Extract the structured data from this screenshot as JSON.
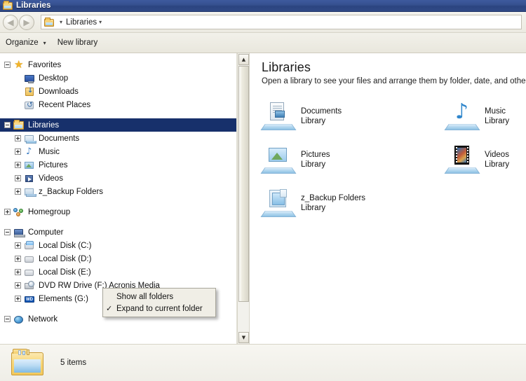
{
  "window": {
    "title": "Libraries",
    "icon": "libraries-folder-icon"
  },
  "navbar": {
    "back_icon": "back-arrow-icon",
    "forward_icon": "forward-arrow-icon",
    "address_icon": "libraries-folder-icon",
    "crumb": "Libraries",
    "crumb_caret": "▾",
    "icon_caret": "▾"
  },
  "commandbar": {
    "organize": "Organize",
    "organize_caret": "▾",
    "new_library": "New library"
  },
  "tree": {
    "groups": [
      {
        "name": "favorites",
        "items": [
          {
            "label": "Favorites",
            "icon": "star-icon",
            "expander": "minus",
            "indent": 0,
            "selected": false
          },
          {
            "label": "Desktop",
            "icon": "desktop-icon",
            "expander": "none",
            "indent": 1,
            "selected": false
          },
          {
            "label": "Downloads",
            "icon": "downloads-icon",
            "expander": "none",
            "indent": 1,
            "selected": false
          },
          {
            "label": "Recent Places",
            "icon": "recent-places-icon",
            "expander": "none",
            "indent": 1,
            "selected": false
          }
        ]
      },
      {
        "name": "libraries",
        "items": [
          {
            "label": "Libraries",
            "icon": "libraries-folder-icon",
            "expander": "minus",
            "indent": 0,
            "selected": true
          },
          {
            "label": "Documents",
            "icon": "documents-library-icon",
            "expander": "plus",
            "indent": 1,
            "selected": false
          },
          {
            "label": "Music",
            "icon": "music-library-icon",
            "expander": "plus",
            "indent": 1,
            "selected": false
          },
          {
            "label": "Pictures",
            "icon": "pictures-library-icon",
            "expander": "plus",
            "indent": 1,
            "selected": false
          },
          {
            "label": "Videos",
            "icon": "videos-library-icon",
            "expander": "plus",
            "indent": 1,
            "selected": false
          },
          {
            "label": "z_Backup Folders",
            "icon": "backup-library-icon",
            "expander": "plus",
            "indent": 1,
            "selected": false
          }
        ]
      },
      {
        "name": "homegroup",
        "items": [
          {
            "label": "Homegroup",
            "icon": "homegroup-icon",
            "expander": "plus",
            "indent": 0,
            "selected": false
          }
        ]
      },
      {
        "name": "computer",
        "items": [
          {
            "label": "Computer",
            "icon": "computer-icon",
            "expander": "minus",
            "indent": 0,
            "selected": false
          },
          {
            "label": "Local Disk (C:)",
            "icon": "system-disk-icon",
            "expander": "plus",
            "indent": 1,
            "selected": false
          },
          {
            "label": "Local Disk (D:)",
            "icon": "disk-icon",
            "expander": "plus",
            "indent": 1,
            "selected": false
          },
          {
            "label": "Local Disk (E:)",
            "icon": "disk-icon",
            "expander": "plus",
            "indent": 1,
            "selected": false
          },
          {
            "label": "DVD RW Drive (F:) Acronis Media",
            "icon": "dvd-drive-icon",
            "expander": "plus",
            "indent": 1,
            "selected": false
          },
          {
            "label": "Elements (G:)",
            "icon": "wd-drive-icon",
            "expander": "plus",
            "indent": 1,
            "selected": false
          }
        ]
      },
      {
        "name": "network",
        "items": [
          {
            "label": "Network",
            "icon": "network-icon",
            "expander": "minus",
            "indent": 0,
            "selected": false
          }
        ]
      }
    ],
    "scrollbar": {
      "up_arrow": "▲",
      "down_arrow": "▼"
    }
  },
  "context_menu": {
    "items": [
      {
        "label": "Show all folders",
        "checked": false,
        "check_glyph": ""
      },
      {
        "label": "Expand to current folder",
        "checked": true,
        "check_glyph": "✓"
      }
    ]
  },
  "pane": {
    "heading": "Libraries",
    "description": "Open a library to see your files and arrange them by folder, date, and other pro",
    "libraries": [
      {
        "name": "Documents",
        "sub": "Library",
        "icon": "documents-library-icon"
      },
      {
        "name": "Music",
        "sub": "Library",
        "icon": "music-library-icon"
      },
      {
        "name": "Pictures",
        "sub": "Library",
        "icon": "pictures-library-icon"
      },
      {
        "name": "Videos",
        "sub": "Library",
        "icon": "videos-library-icon"
      },
      {
        "name": "z_Backup Folders",
        "sub": "Library",
        "icon": "backup-library-icon"
      }
    ]
  },
  "statusbar": {
    "icon": "libraries-folder-icon",
    "count": "5 items"
  },
  "colors": {
    "titlebar": "#35508f",
    "selection": "#17306b",
    "chrome": "#efeee7",
    "pane_bg": "#ffffff"
  }
}
